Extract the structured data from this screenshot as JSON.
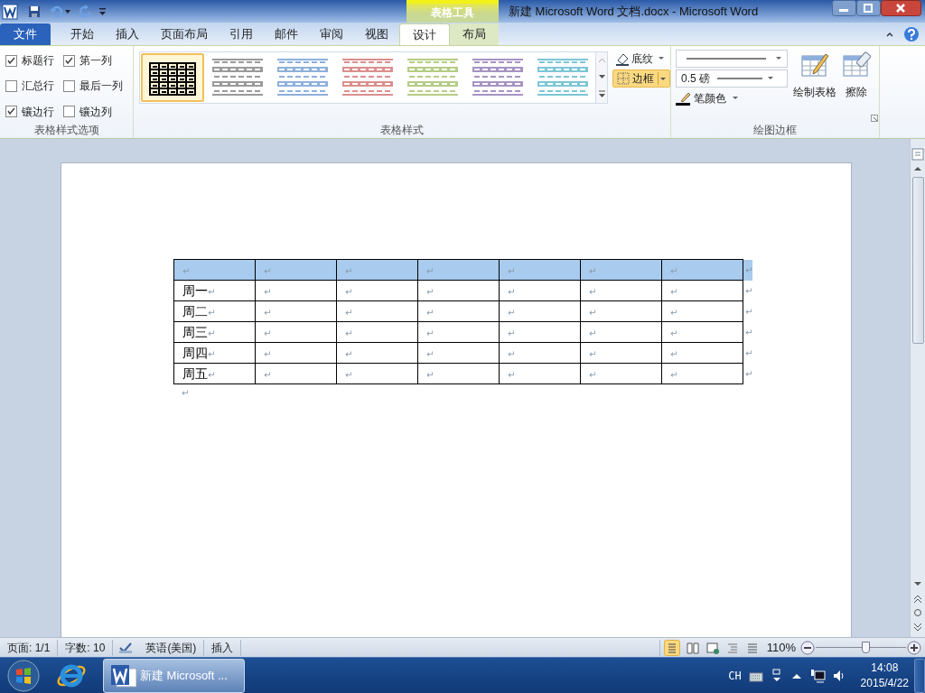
{
  "window": {
    "title": "新建 Microsoft Word 文档.docx  -  Microsoft Word",
    "context_tab_group": "表格工具"
  },
  "ribbon_tabs": [
    {
      "label": "文件",
      "kind": "file",
      "selected": false
    },
    {
      "label": "开始",
      "kind": "normal",
      "selected": false
    },
    {
      "label": "插入",
      "kind": "normal",
      "selected": false
    },
    {
      "label": "页面布局",
      "kind": "normal",
      "selected": false
    },
    {
      "label": "引用",
      "kind": "normal",
      "selected": false
    },
    {
      "label": "邮件",
      "kind": "normal",
      "selected": false
    },
    {
      "label": "审阅",
      "kind": "normal",
      "selected": false
    },
    {
      "label": "视图",
      "kind": "normal",
      "selected": false
    },
    {
      "label": "设计",
      "kind": "context",
      "selected": true
    },
    {
      "label": "布局",
      "kind": "context",
      "selected": false
    }
  ],
  "style_options": {
    "label": "表格样式选项",
    "options": [
      {
        "label": "标题行",
        "checked": true
      },
      {
        "label": "第一列",
        "checked": true
      },
      {
        "label": "汇总行",
        "checked": false
      },
      {
        "label": "最后一列",
        "checked": false
      },
      {
        "label": "镶边行",
        "checked": true
      },
      {
        "label": "镶边列",
        "checked": false
      }
    ]
  },
  "table_styles": {
    "label": "表格样式",
    "styles": [
      {
        "kind": "grid",
        "color": "#000000",
        "selected": true
      },
      {
        "kind": "banded",
        "color": "#9a9a9a",
        "selected": false
      },
      {
        "kind": "banded",
        "color": "#8eb0dc",
        "selected": false
      },
      {
        "kind": "banded",
        "color": "#dc8f8f",
        "selected": false
      },
      {
        "kind": "banded",
        "color": "#b6cc84",
        "selected": false
      },
      {
        "kind": "banded",
        "color": "#a793c4",
        "selected": false
      },
      {
        "kind": "banded",
        "color": "#7cc6d6",
        "selected": false
      }
    ],
    "shading": "底纹",
    "borders": "边框"
  },
  "draw_borders": {
    "label": "绘图边框",
    "line_weight": "0.5 磅",
    "pen_color": "笔颜色",
    "draw_table": "绘制表格",
    "eraser": "擦除"
  },
  "table": {
    "rows": [
      {
        "selected": true,
        "cells": [
          {
            "text": "",
            "mark": "↵"
          },
          {
            "text": "",
            "mark": "↵"
          },
          {
            "text": "",
            "mark": "↵"
          },
          {
            "text": "",
            "mark": "↵"
          },
          {
            "text": "",
            "mark": "↵"
          },
          {
            "text": "",
            "mark": "↵"
          },
          {
            "text": "",
            "mark": "↵"
          }
        ],
        "end_mark": "↵"
      },
      {
        "selected": false,
        "cells": [
          {
            "text": "周一",
            "mark": "↵"
          },
          {
            "text": "",
            "mark": "↵"
          },
          {
            "text": "",
            "mark": "↵"
          },
          {
            "text": "",
            "mark": "↵"
          },
          {
            "text": "",
            "mark": "↵"
          },
          {
            "text": "",
            "mark": "↵"
          },
          {
            "text": "",
            "mark": "↵"
          }
        ],
        "end_mark": "↵"
      },
      {
        "selected": false,
        "cells": [
          {
            "text": "周二",
            "mark": "↵"
          },
          {
            "text": "",
            "mark": "↵"
          },
          {
            "text": "",
            "mark": "↵"
          },
          {
            "text": "",
            "mark": "↵"
          },
          {
            "text": "",
            "mark": "↵"
          },
          {
            "text": "",
            "mark": "↵"
          },
          {
            "text": "",
            "mark": "↵"
          }
        ],
        "end_mark": "↵"
      },
      {
        "selected": false,
        "cells": [
          {
            "text": "周三",
            "mark": "↵"
          },
          {
            "text": "",
            "mark": "↵"
          },
          {
            "text": "",
            "mark": "↵"
          },
          {
            "text": "",
            "mark": "↵"
          },
          {
            "text": "",
            "mark": "↵"
          },
          {
            "text": "",
            "mark": "↵"
          },
          {
            "text": "",
            "mark": "↵"
          }
        ],
        "end_mark": "↵"
      },
      {
        "selected": false,
        "cells": [
          {
            "text": "周四",
            "mark": "↵"
          },
          {
            "text": "",
            "mark": "↵"
          },
          {
            "text": "",
            "mark": "↵"
          },
          {
            "text": "",
            "mark": "↵"
          },
          {
            "text": "",
            "mark": "↵"
          },
          {
            "text": "",
            "mark": "↵"
          },
          {
            "text": "",
            "mark": "↵"
          }
        ],
        "end_mark": "↵"
      },
      {
        "selected": false,
        "cells": [
          {
            "text": "周五",
            "mark": "↵"
          },
          {
            "text": "",
            "mark": "↵"
          },
          {
            "text": "",
            "mark": "↵"
          },
          {
            "text": "",
            "mark": "↵"
          },
          {
            "text": "",
            "mark": "↵"
          },
          {
            "text": "",
            "mark": "↵"
          },
          {
            "text": "",
            "mark": "↵"
          }
        ],
        "end_mark": "↵"
      }
    ],
    "after_mark": "↵"
  },
  "status_bar": {
    "items": [
      "页面: 1/1",
      "字数: 10",
      "英语(美国)",
      "插入"
    ],
    "zoom": "110%",
    "zoom_level": {
      "level": 0.55
    }
  },
  "taskbar": {
    "window_button": "新建 Microsoft ...",
    "language": "CH",
    "time": "14:08",
    "date": "2015/4/22"
  }
}
